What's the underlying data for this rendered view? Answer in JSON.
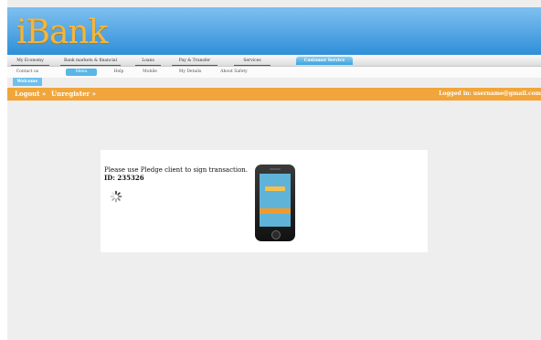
{
  "app": {
    "logo": "iBank"
  },
  "nav": {
    "main_tabs": [
      {
        "label": "My Economy",
        "active": false
      },
      {
        "label": "Bank markets & financial",
        "active": false
      },
      {
        "label": "Loans",
        "active": false
      },
      {
        "label": "Pay & Transfer",
        "active": false
      },
      {
        "label": "Services",
        "active": false
      },
      {
        "label": "Customer Service",
        "active": true
      }
    ],
    "sub_items": [
      {
        "label": "Contact us",
        "active": false
      },
      {
        "label": "Menu",
        "active": true
      },
      {
        "label": "Help",
        "active": false
      },
      {
        "label": "Mobile",
        "active": false
      },
      {
        "label": "My Details",
        "active": false
      },
      {
        "label": "About Safety",
        "active": false
      }
    ],
    "welcome_label": "Welcome"
  },
  "account_bar": {
    "logout_label": "Logout »",
    "unregister_label": "Unregister »",
    "logged_in_text": "Logged in: username@gmail.com"
  },
  "sign_panel": {
    "message": "Please use Pledge client to sign transaction.",
    "transaction_id": "ID: 235326"
  },
  "colors": {
    "header_blue": "#2f8fd8",
    "logo_gold": "#f2b640",
    "accent_orange": "#f1a53a",
    "tab_active": "#58b6e8"
  }
}
